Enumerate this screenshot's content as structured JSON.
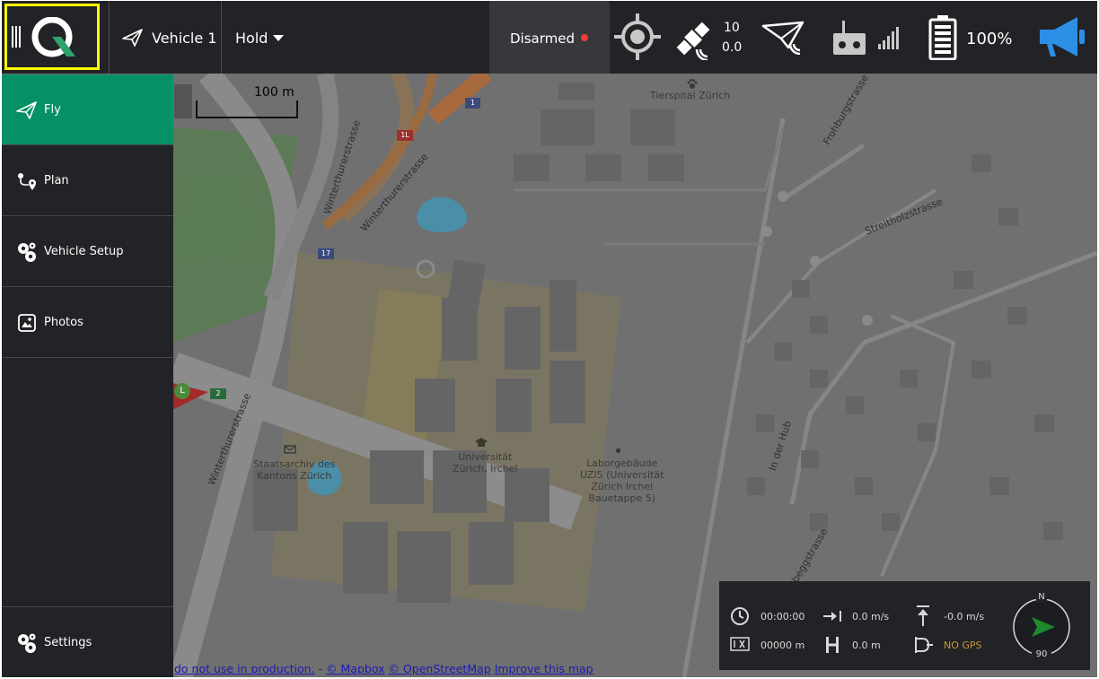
{
  "toolbar": {
    "vehicle_label": "Vehicle 1",
    "flight_mode": "Hold",
    "arm_status": "Disarmed",
    "arm_status_color": "#f03c3c",
    "gps_satellites": "10",
    "gps_hdop": "0.0",
    "battery": "100%",
    "icons": [
      "menu-icon",
      "qgc-logo",
      "paper-plane-icon",
      "chevron-down-icon",
      "status-dot-icon",
      "gimbal-target-icon",
      "satellite-icon",
      "vehicle-message-icon",
      "rc-remote-icon",
      "signal-bars-icon",
      "battery-icon",
      "megaphone-icon"
    ]
  },
  "sidebar": {
    "items": [
      {
        "label": "Fly",
        "icon": "paper-plane-icon",
        "active": true
      },
      {
        "label": "Plan",
        "icon": "plan-route-icon",
        "active": false
      },
      {
        "label": "Vehicle Setup",
        "icon": "gears-icon",
        "active": false
      },
      {
        "label": "Photos",
        "icon": "photos-icon",
        "active": false
      }
    ],
    "settings_label": "Settings"
  },
  "map": {
    "scale_label": "100 m",
    "labels": {
      "tierspital": "Tierspital Zürich",
      "universitaet": "Universität\nZürich, Irchel",
      "laborgebaeude": "Laborgebäude\nUZI5 (Universität\nZürich Irchel\nBauetappe 5)",
      "staatsarchiv": "Staatsarchiv des\nKantons Zürich",
      "winterthurerstrasse": "Winterthurerstrasse",
      "frohburgstrasse": "Frohburgstrasse",
      "streitholzstrasse": "Streitholzstrasse",
      "in_der_hub": "In der Hub",
      "beggstrasse": "beggstrasse",
      "road_1": "1",
      "road_1l": "1L",
      "road_17": "17",
      "road_2": "2",
      "l_marker": "L"
    },
    "attribution": {
      "prefix": "do not use in production.",
      "sep": " - ",
      "mapbox": "© Mapbox",
      "osm": "© OpenStreetMap",
      "improve": "Improve this map"
    }
  },
  "instrument": {
    "flight_time": "00:00:00",
    "distance": "00000 m",
    "ground_speed": "0.0 m/s",
    "altitude": "0.0 m",
    "climb_rate": "-0.0 m/s",
    "gps_status": "NO GPS",
    "gps_status_color": "#c8963c",
    "compass_north": "N",
    "heading": "90"
  }
}
